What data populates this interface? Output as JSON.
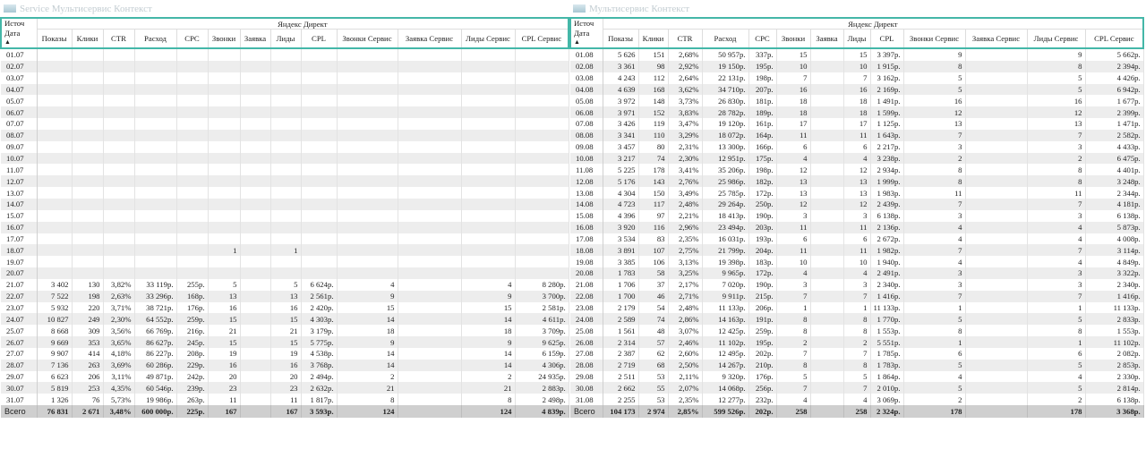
{
  "left": {
    "title": "Service Мультисервис Контекст",
    "source_label": "Источ",
    "date_label": "Дата",
    "group_label": "Яндекс Директ",
    "columns": [
      "Показы",
      "Клики",
      "CTR",
      "Расход",
      "CPC",
      "Звонки",
      "Заявка",
      "Лиды",
      "CPL",
      "Звонки Сервис",
      "Заявка Сервис",
      "Лиды Сервис",
      "CPL Сервис"
    ],
    "rows": [
      [
        "01.07",
        "",
        "",
        "",
        "",
        "",
        "",
        "",
        "",
        "",
        "",
        "",
        "",
        ""
      ],
      [
        "02.07",
        "",
        "",
        "",
        "",
        "",
        "",
        "",
        "",
        "",
        "",
        "",
        "",
        ""
      ],
      [
        "03.07",
        "",
        "",
        "",
        "",
        "",
        "",
        "",
        "",
        "",
        "",
        "",
        "",
        ""
      ],
      [
        "04.07",
        "",
        "",
        "",
        "",
        "",
        "",
        "",
        "",
        "",
        "",
        "",
        "",
        ""
      ],
      [
        "05.07",
        "",
        "",
        "",
        "",
        "",
        "",
        "",
        "",
        "",
        "",
        "",
        "",
        ""
      ],
      [
        "06.07",
        "",
        "",
        "",
        "",
        "",
        "",
        "",
        "",
        "",
        "",
        "",
        "",
        ""
      ],
      [
        "07.07",
        "",
        "",
        "",
        "",
        "",
        "",
        "",
        "",
        "",
        "",
        "",
        "",
        ""
      ],
      [
        "08.07",
        "",
        "",
        "",
        "",
        "",
        "",
        "",
        "",
        "",
        "",
        "",
        "",
        ""
      ],
      [
        "09.07",
        "",
        "",
        "",
        "",
        "",
        "",
        "",
        "",
        "",
        "",
        "",
        "",
        ""
      ],
      [
        "10.07",
        "",
        "",
        "",
        "",
        "",
        "",
        "",
        "",
        "",
        "",
        "",
        "",
        ""
      ],
      [
        "11.07",
        "",
        "",
        "",
        "",
        "",
        "",
        "",
        "",
        "",
        "",
        "",
        "",
        ""
      ],
      [
        "12.07",
        "",
        "",
        "",
        "",
        "",
        "",
        "",
        "",
        "",
        "",
        "",
        "",
        ""
      ],
      [
        "13.07",
        "",
        "",
        "",
        "",
        "",
        "",
        "",
        "",
        "",
        "",
        "",
        "",
        ""
      ],
      [
        "14.07",
        "",
        "",
        "",
        "",
        "",
        "",
        "",
        "",
        "",
        "",
        "",
        "",
        ""
      ],
      [
        "15.07",
        "",
        "",
        "",
        "",
        "",
        "",
        "",
        "",
        "",
        "",
        "",
        "",
        ""
      ],
      [
        "16.07",
        "",
        "",
        "",
        "",
        "",
        "",
        "",
        "",
        "",
        "",
        "",
        "",
        ""
      ],
      [
        "17.07",
        "",
        "",
        "",
        "",
        "",
        "",
        "",
        "",
        "",
        "",
        "",
        "",
        ""
      ],
      [
        "18.07",
        "",
        "",
        "",
        "",
        "",
        "1",
        "",
        "1",
        "",
        "",
        "",
        "",
        ""
      ],
      [
        "19.07",
        "",
        "",
        "",
        "",
        "",
        "",
        "",
        "",
        "",
        "",
        "",
        "",
        ""
      ],
      [
        "20.07",
        "",
        "",
        "",
        "",
        "",
        "",
        "",
        "",
        "",
        "",
        "",
        "",
        ""
      ],
      [
        "21.07",
        "3 402",
        "130",
        "3,82%",
        "33 119р.",
        "255р.",
        "5",
        "",
        "5",
        "6 624р.",
        "4",
        "",
        "4",
        "8 280р."
      ],
      [
        "22.07",
        "7 522",
        "198",
        "2,63%",
        "33 296р.",
        "168р.",
        "13",
        "",
        "13",
        "2 561р.",
        "9",
        "",
        "9",
        "3 700р."
      ],
      [
        "23.07",
        "5 932",
        "220",
        "3,71%",
        "38 721р.",
        "176р.",
        "16",
        "",
        "16",
        "2 420р.",
        "15",
        "",
        "15",
        "2 581р."
      ],
      [
        "24.07",
        "10 827",
        "249",
        "2,30%",
        "64 552р.",
        "259р.",
        "15",
        "",
        "15",
        "4 303р.",
        "14",
        "",
        "14",
        "4 611р."
      ],
      [
        "25.07",
        "8 668",
        "309",
        "3,56%",
        "66 769р.",
        "216р.",
        "21",
        "",
        "21",
        "3 179р.",
        "18",
        "",
        "18",
        "3 709р."
      ],
      [
        "26.07",
        "9 669",
        "353",
        "3,65%",
        "86 627р.",
        "245р.",
        "15",
        "",
        "15",
        "5 775р.",
        "9",
        "",
        "9",
        "9 625р."
      ],
      [
        "27.07",
        "9 907",
        "414",
        "4,18%",
        "86 227р.",
        "208р.",
        "19",
        "",
        "19",
        "4 538р.",
        "14",
        "",
        "14",
        "6 159р."
      ],
      [
        "28.07",
        "7 136",
        "263",
        "3,69%",
        "60 286р.",
        "229р.",
        "16",
        "",
        "16",
        "3 768р.",
        "14",
        "",
        "14",
        "4 306р."
      ],
      [
        "29.07",
        "6 623",
        "206",
        "3,11%",
        "49 871р.",
        "242р.",
        "20",
        "",
        "20",
        "2 494р.",
        "2",
        "",
        "2",
        "24 935р."
      ],
      [
        "30.07",
        "5 819",
        "253",
        "4,35%",
        "60 546р.",
        "239р.",
        "23",
        "",
        "23",
        "2 632р.",
        "21",
        "",
        "21",
        "2 883р."
      ],
      [
        "31.07",
        "1 326",
        "76",
        "5,73%",
        "19 986р.",
        "263р.",
        "11",
        "",
        "11",
        "1 817р.",
        "8",
        "",
        "8",
        "2 498р."
      ]
    ],
    "total": [
      "Всего",
      "76 831",
      "2 671",
      "3,48%",
      "600 000р.",
      "225р.",
      "167",
      "",
      "167",
      "3 593р.",
      "124",
      "",
      "124",
      "4 839р."
    ]
  },
  "right": {
    "title": "Мультисервис Контекст",
    "source_label": "Источ",
    "date_label": "Дата",
    "group_label": "Яндекс Директ",
    "columns": [
      "Показы",
      "Клики",
      "CTR",
      "Расход",
      "CPC",
      "Звонки",
      "Заявка",
      "Лиды",
      "CPL",
      "Звонки Сервис",
      "Заявка Сервис",
      "Лиды Сервис",
      "CPL Сервис"
    ],
    "rows": [
      [
        "01.08",
        "5 626",
        "151",
        "2,68%",
        "50 957р.",
        "337р.",
        "15",
        "",
        "15",
        "3 397р.",
        "9",
        "",
        "9",
        "5 662р."
      ],
      [
        "02.08",
        "3 361",
        "98",
        "2,92%",
        "19 150р.",
        "195р.",
        "10",
        "",
        "10",
        "1 915р.",
        "8",
        "",
        "8",
        "2 394р."
      ],
      [
        "03.08",
        "4 243",
        "112",
        "2,64%",
        "22 131р.",
        "198р.",
        "7",
        "",
        "7",
        "3 162р.",
        "5",
        "",
        "5",
        "4 426р."
      ],
      [
        "04.08",
        "4 639",
        "168",
        "3,62%",
        "34 710р.",
        "207р.",
        "16",
        "",
        "16",
        "2 169р.",
        "5",
        "",
        "5",
        "6 942р."
      ],
      [
        "05.08",
        "3 972",
        "148",
        "3,73%",
        "26 830р.",
        "181р.",
        "18",
        "",
        "18",
        "1 491р.",
        "16",
        "",
        "16",
        "1 677р."
      ],
      [
        "06.08",
        "3 971",
        "152",
        "3,83%",
        "28 782р.",
        "189р.",
        "18",
        "",
        "18",
        "1 599р.",
        "12",
        "",
        "12",
        "2 399р."
      ],
      [
        "07.08",
        "3 426",
        "119",
        "3,47%",
        "19 120р.",
        "161р.",
        "17",
        "",
        "17",
        "1 125р.",
        "13",
        "",
        "13",
        "1 471р."
      ],
      [
        "08.08",
        "3 341",
        "110",
        "3,29%",
        "18 072р.",
        "164р.",
        "11",
        "",
        "11",
        "1 643р.",
        "7",
        "",
        "7",
        "2 582р."
      ],
      [
        "09.08",
        "3 457",
        "80",
        "2,31%",
        "13 300р.",
        "166р.",
        "6",
        "",
        "6",
        "2 217р.",
        "3",
        "",
        "3",
        "4 433р."
      ],
      [
        "10.08",
        "3 217",
        "74",
        "2,30%",
        "12 951р.",
        "175р.",
        "4",
        "",
        "4",
        "3 238р.",
        "2",
        "",
        "2",
        "6 475р."
      ],
      [
        "11.08",
        "5 225",
        "178",
        "3,41%",
        "35 206р.",
        "198р.",
        "12",
        "",
        "12",
        "2 934р.",
        "8",
        "",
        "8",
        "4 401р."
      ],
      [
        "12.08",
        "5 176",
        "143",
        "2,76%",
        "25 986р.",
        "182р.",
        "13",
        "",
        "13",
        "1 999р.",
        "8",
        "",
        "8",
        "3 248р."
      ],
      [
        "13.08",
        "4 304",
        "150",
        "3,49%",
        "25 785р.",
        "172р.",
        "13",
        "",
        "13",
        "1 983р.",
        "11",
        "",
        "11",
        "2 344р."
      ],
      [
        "14.08",
        "4 723",
        "117",
        "2,48%",
        "29 264р.",
        "250р.",
        "12",
        "",
        "12",
        "2 439р.",
        "7",
        "",
        "7",
        "4 181р."
      ],
      [
        "15.08",
        "4 396",
        "97",
        "2,21%",
        "18 413р.",
        "190р.",
        "3",
        "",
        "3",
        "6 138р.",
        "3",
        "",
        "3",
        "6 138р."
      ],
      [
        "16.08",
        "3 920",
        "116",
        "2,96%",
        "23 494р.",
        "203р.",
        "11",
        "",
        "11",
        "2 136р.",
        "4",
        "",
        "4",
        "5 873р."
      ],
      [
        "17.08",
        "3 534",
        "83",
        "2,35%",
        "16 031р.",
        "193р.",
        "6",
        "",
        "6",
        "2 672р.",
        "4",
        "",
        "4",
        "4 008р."
      ],
      [
        "18.08",
        "3 891",
        "107",
        "2,75%",
        "21 799р.",
        "204р.",
        "11",
        "",
        "11",
        "1 982р.",
        "7",
        "",
        "7",
        "3 114р."
      ],
      [
        "19.08",
        "3 385",
        "106",
        "3,13%",
        "19 398р.",
        "183р.",
        "10",
        "",
        "10",
        "1 940р.",
        "4",
        "",
        "4",
        "4 849р."
      ],
      [
        "20.08",
        "1 783",
        "58",
        "3,25%",
        "9 965р.",
        "172р.",
        "4",
        "",
        "4",
        "2 491р.",
        "3",
        "",
        "3",
        "3 322р."
      ],
      [
        "21.08",
        "1 706",
        "37",
        "2,17%",
        "7 020р.",
        "190р.",
        "3",
        "",
        "3",
        "2 340р.",
        "3",
        "",
        "3",
        "2 340р."
      ],
      [
        "22.08",
        "1 700",
        "46",
        "2,71%",
        "9 911р.",
        "215р.",
        "7",
        "",
        "7",
        "1 416р.",
        "7",
        "",
        "7",
        "1 416р."
      ],
      [
        "23.08",
        "2 179",
        "54",
        "2,48%",
        "11 133р.",
        "206р.",
        "1",
        "",
        "1",
        "11 133р.",
        "1",
        "",
        "1",
        "11 133р."
      ],
      [
        "24.08",
        "2 589",
        "74",
        "2,86%",
        "14 163р.",
        "191р.",
        "8",
        "",
        "8",
        "1 770р.",
        "5",
        "",
        "5",
        "2 833р."
      ],
      [
        "25.08",
        "1 561",
        "48",
        "3,07%",
        "12 425р.",
        "259р.",
        "8",
        "",
        "8",
        "1 553р.",
        "8",
        "",
        "8",
        "1 553р."
      ],
      [
        "26.08",
        "2 314",
        "57",
        "2,46%",
        "11 102р.",
        "195р.",
        "2",
        "",
        "2",
        "5 551р.",
        "1",
        "",
        "1",
        "11 102р."
      ],
      [
        "27.08",
        "2 387",
        "62",
        "2,60%",
        "12 495р.",
        "202р.",
        "7",
        "",
        "7",
        "1 785р.",
        "6",
        "",
        "6",
        "2 082р."
      ],
      [
        "28.08",
        "2 719",
        "68",
        "2,50%",
        "14 267р.",
        "210р.",
        "8",
        "",
        "8",
        "1 783р.",
        "5",
        "",
        "5",
        "2 853р."
      ],
      [
        "29.08",
        "2 511",
        "53",
        "2,11%",
        "9 320р.",
        "176р.",
        "5",
        "",
        "5",
        "1 864р.",
        "4",
        "",
        "4",
        "2 330р."
      ],
      [
        "30.08",
        "2 662",
        "55",
        "2,07%",
        "14 068р.",
        "256р.",
        "7",
        "",
        "7",
        "2 010р.",
        "5",
        "",
        "5",
        "2 814р."
      ],
      [
        "31.08",
        "2 255",
        "53",
        "2,35%",
        "12 277р.",
        "232р.",
        "4",
        "",
        "4",
        "3 069р.",
        "2",
        "",
        "2",
        "6 138р."
      ]
    ],
    "total": [
      "Всего",
      "104 173",
      "2 974",
      "2,85%",
      "599 526р.",
      "202р.",
      "258",
      "",
      "258",
      "2 324р.",
      "178",
      "",
      "178",
      "3 368р."
    ]
  }
}
